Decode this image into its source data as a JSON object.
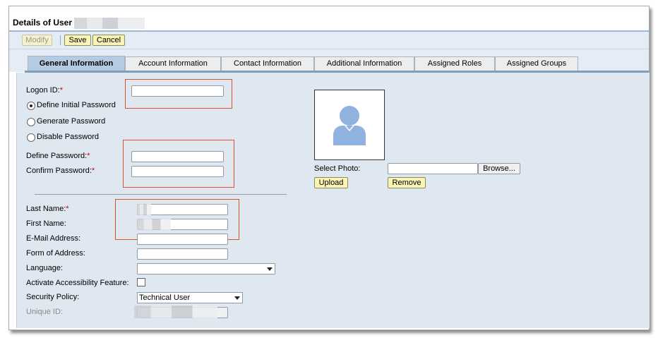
{
  "window": {
    "title": "Details of User"
  },
  "toolbar": {
    "modify": "Modify",
    "save": "Save",
    "cancel": "Cancel"
  },
  "tabs": [
    {
      "label": "General Information",
      "active": true
    },
    {
      "label": "Account Information"
    },
    {
      "label": "Contact Information"
    },
    {
      "label": "Additional Information"
    },
    {
      "label": "Assigned Roles"
    },
    {
      "label": "Assigned Groups"
    }
  ],
  "form": {
    "logon_id": "Logon ID:",
    "define_initial_password": "Define Initial Password",
    "generate_password": "Generate Password",
    "disable_password": "Disable Password",
    "define_password": "Define Password:",
    "confirm_password": "Confirm Password:",
    "last_name": "Last Name:",
    "first_name": "First Name:",
    "email": "E-Mail Address:",
    "form_of_address": "Form of Address:",
    "language": "Language:",
    "accessibility": "Activate Accessibility Feature:",
    "security_policy": "Security Policy:",
    "security_policy_value": "Technical User",
    "unique_id": "Unique ID:",
    "required_marker": "*"
  },
  "photo": {
    "select_photo": "Select Photo:",
    "browse": "Browse...",
    "upload": "Upload",
    "remove": "Remove"
  },
  "colors": {
    "annotation_red": "#d9532a",
    "button_yellow": "#fcf3b6",
    "active_tab": "#b4cbe1",
    "panel_bg": "#dfe8f1",
    "avatar_blue": "#8fb2df"
  }
}
